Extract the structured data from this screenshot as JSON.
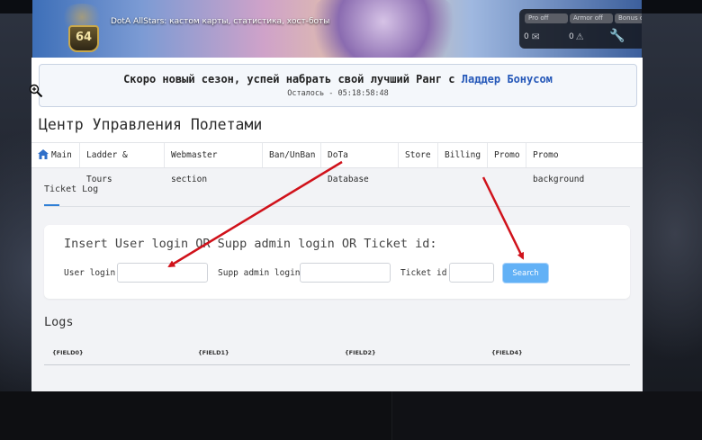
{
  "banner": {
    "site_title": "DotA AllStars: кастом карты, статистика, хост-боты",
    "level": "64",
    "pills": [
      "Pro off",
      "Armor off",
      "Bonus off"
    ],
    "counters": [
      "0",
      "0"
    ]
  },
  "notice": {
    "text": "Скоро новый сезон, успей набрать свой лучший Ранг с ",
    "link": "Ладдер Бонусом",
    "countdown": "Осталось - 05:18:58:48"
  },
  "page_title": "Центр Управления Полетами",
  "nav": {
    "items": [
      "Main",
      "Ladder & Tours",
      "Webmaster section",
      "Ban/UnBan",
      "DoTa Database",
      "Store",
      "Billing",
      "Promo",
      "Promo background"
    ]
  },
  "tab": {
    "label": "Ticket Log"
  },
  "search": {
    "prompt": "Insert User login OR Supp admin login OR Ticket id:",
    "user_login_label": "User login",
    "supp_admin_label": "Supp admin login",
    "ticket_id_label": "Ticket id",
    "user_login_value": "",
    "supp_admin_value": "",
    "ticket_id_value": "",
    "button_label": "Search"
  },
  "logs": {
    "title": "Logs",
    "columns": [
      "{FIELD0}",
      "{FIELD1}",
      "{FIELD2}",
      "{FIELD4}"
    ]
  },
  "colors": {
    "accent": "#2f7fd6",
    "button": "#62b1f6",
    "link": "#2457b8",
    "annotation_arrow": "#d0121b"
  }
}
